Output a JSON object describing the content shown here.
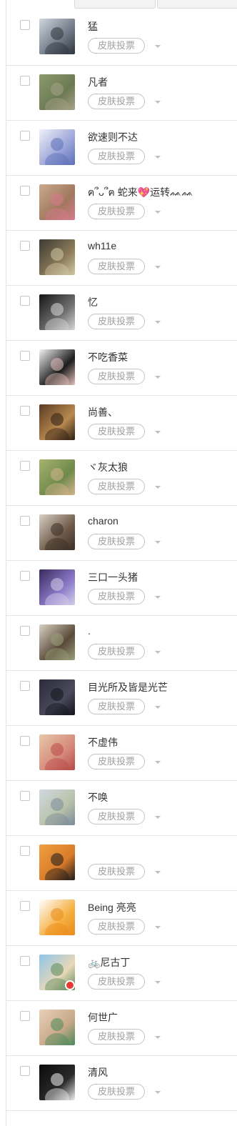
{
  "vote_label": "皮肤投票",
  "users": [
    {
      "name": "猛",
      "colors": [
        "#cfd6de",
        "#6f7985",
        "#2e343b"
      ]
    },
    {
      "name": "凡者",
      "colors": [
        "#8c9a6e",
        "#6b7a52",
        "#a8a28a"
      ]
    },
    {
      "name": "欲速则不达",
      "colors": [
        "#eef0f7",
        "#9aa4d8",
        "#5c6fb8"
      ]
    },
    {
      "name": "ฅ՞ᴗ՞ฅ 蛇来💖运转ᨐᨐ",
      "colors": [
        "#c9a98d",
        "#a0785e",
        "#d97a8e"
      ]
    },
    {
      "name": "wh11e",
      "colors": [
        "#3b3a34",
        "#8a7a58",
        "#d2c8a6"
      ]
    },
    {
      "name": "忆",
      "colors": [
        "#151515",
        "#6f6f6f",
        "#d8d8d8"
      ]
    },
    {
      "name": "不吃香菜",
      "colors": [
        "#f3f3f3",
        "#1c1c1c",
        "#e6c1bd"
      ]
    },
    {
      "name": "尚善、",
      "colors": [
        "#5a3a24",
        "#b98a4f",
        "#2e1d14"
      ]
    },
    {
      "name": "ヾ灰太狼",
      "colors": [
        "#a8b26e",
        "#6e8a4c",
        "#d6b48c"
      ]
    },
    {
      "name": "charon",
      "colors": [
        "#d8d0c4",
        "#6e5a4a",
        "#3a2e26"
      ]
    },
    {
      "name": "三口一头猪",
      "colors": [
        "#3a2a5e",
        "#8a7ac8",
        "#d6d0ea"
      ]
    },
    {
      "name": ".",
      "colors": [
        "#d9d2c2",
        "#5a4a3a",
        "#9aa07a"
      ]
    },
    {
      "name": "目光所及皆是光芒",
      "colors": [
        "#2a2a3a",
        "#4a4a5c",
        "#14141c"
      ]
    },
    {
      "name": "不虚伟",
      "colors": [
        "#e6c8a8",
        "#d68a7a",
        "#b84a4a"
      ]
    },
    {
      "name": "不唤",
      "colors": [
        "#cfd8e0",
        "#b8c2a8",
        "#7a8a9a"
      ]
    },
    {
      "name": "",
      "colors": [
        "#f0a040",
        "#d87a2a",
        "#1a1a1a"
      ]
    },
    {
      "name": "Being 亮亮",
      "colors": [
        "#ffffff",
        "#f5b042",
        "#ea8a1a"
      ]
    },
    {
      "name": "🚲尼古丁",
      "colors": [
        "#8ec4e8",
        "#e8d8b8",
        "#5a8a5a"
      ]
    },
    {
      "name": "何世广",
      "colors": [
        "#e8d0b8",
        "#c8a888",
        "#4a8a5a"
      ]
    },
    {
      "name": "清风",
      "colors": [
        "#0a0a0a",
        "#2a2a2a",
        "#f0f0f0"
      ]
    }
  ],
  "badge_row": 17,
  "badge_color": "#e53935"
}
